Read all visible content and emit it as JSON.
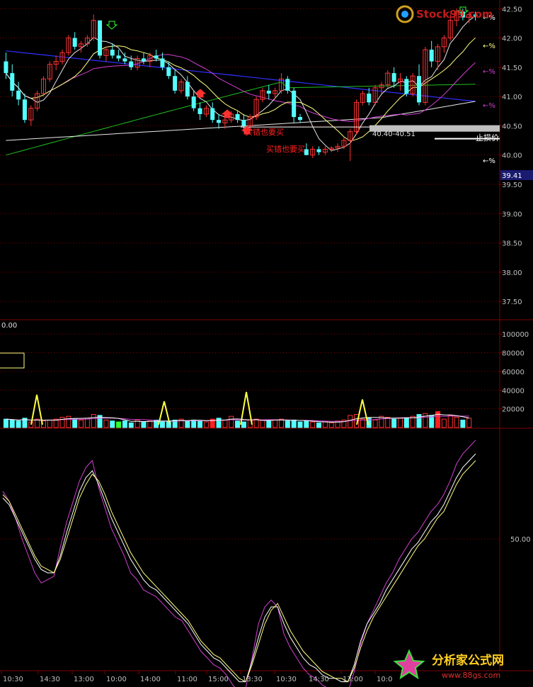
{
  "watermark_top": "Stock99.com",
  "watermark_bottom": {
    "title": "分析家公式网",
    "url": "www.88gs.com"
  },
  "colors": {
    "bg": "#000000",
    "grid": "#800000",
    "axis_text": "#c0c0c0",
    "up": "#ff3232",
    "down": "#54ffff",
    "ma_white": "#e8e8e8",
    "ma_yellow": "#ffff80",
    "ma_magenta": "#d040d0",
    "ma_blue": "#3030ff",
    "ma_green": "#20c020",
    "label_red": "#ff2020",
    "current_price_bg": "#1a1a70"
  },
  "chart_data": [
    {
      "type": "candlestick",
      "panel": "price",
      "ylim": [
        37.2,
        42.6
      ],
      "y_ticks": [
        "42.50",
        "42.00",
        "41.50",
        "41.00",
        "40.50",
        "40.00",
        "39.50",
        "39.00",
        "38.50",
        "38.00",
        "37.50"
      ],
      "current_price": "39.41",
      "candles": [
        [
          41.6,
          41.75,
          41.3,
          41.4
        ],
        [
          41.4,
          41.55,
          41.0,
          41.1
        ],
        [
          41.1,
          41.25,
          40.85,
          40.95
        ],
        [
          40.95,
          41.05,
          40.55,
          40.6
        ],
        [
          40.6,
          40.85,
          40.5,
          40.8
        ],
        [
          40.8,
          41.1,
          40.75,
          41.05
        ],
        [
          41.05,
          41.35,
          41.0,
          41.3
        ],
        [
          41.3,
          41.6,
          41.25,
          41.55
        ],
        [
          41.55,
          41.7,
          41.45,
          41.6
        ],
        [
          41.6,
          41.8,
          41.55,
          41.75
        ],
        [
          41.75,
          42.05,
          41.7,
          42.0
        ],
        [
          42.0,
          42.1,
          41.8,
          41.85
        ],
        [
          41.85,
          41.95,
          41.75,
          41.9
        ],
        [
          41.9,
          42.05,
          41.85,
          42.0
        ],
        [
          42.0,
          42.4,
          41.95,
          42.3
        ],
        [
          42.3,
          42.3,
          41.65,
          41.7
        ],
        [
          41.7,
          41.85,
          41.6,
          41.8
        ],
        [
          41.8,
          41.9,
          41.65,
          41.7
        ],
        [
          41.7,
          41.8,
          41.6,
          41.65
        ],
        [
          41.65,
          41.75,
          41.55,
          41.6
        ],
        [
          41.6,
          41.7,
          41.45,
          41.5
        ],
        [
          41.5,
          41.7,
          41.45,
          41.65
        ],
        [
          41.65,
          41.75,
          41.55,
          41.6
        ],
        [
          41.6,
          41.75,
          41.5,
          41.7
        ],
        [
          41.7,
          41.8,
          41.6,
          41.65
        ],
        [
          41.65,
          41.75,
          41.45,
          41.5
        ],
        [
          41.5,
          41.6,
          41.3,
          41.35
        ],
        [
          41.35,
          41.45,
          41.05,
          41.1
        ],
        [
          41.1,
          41.3,
          41.05,
          41.25
        ],
        [
          41.25,
          41.35,
          40.95,
          41.0
        ],
        [
          41.0,
          41.1,
          40.75,
          40.8
        ],
        [
          40.8,
          40.9,
          40.6,
          40.7
        ],
        [
          40.7,
          40.85,
          40.65,
          40.8
        ],
        [
          40.8,
          40.9,
          40.55,
          40.6
        ],
        [
          40.6,
          40.7,
          40.45,
          40.55
        ],
        [
          40.55,
          40.65,
          40.45,
          40.6
        ],
        [
          40.6,
          40.75,
          40.55,
          40.7
        ],
        [
          40.7,
          40.75,
          40.55,
          40.6
        ],
        [
          40.6,
          40.7,
          40.4,
          40.5
        ],
        [
          40.5,
          40.7,
          40.45,
          40.65
        ],
        [
          40.65,
          41.0,
          40.6,
          40.95
        ],
        [
          40.95,
          41.15,
          40.9,
          41.1
        ],
        [
          41.1,
          41.2,
          40.95,
          41.05
        ],
        [
          41.05,
          41.15,
          40.95,
          41.1
        ],
        [
          41.1,
          41.4,
          41.05,
          41.3
        ],
        [
          41.3,
          41.35,
          41.05,
          41.1
        ],
        [
          41.1,
          41.15,
          40.55,
          40.65
        ],
        [
          40.65,
          40.7,
          40.55,
          40.6
        ],
        [
          40.1,
          40.2,
          40.0,
          40.0
        ],
        [
          40.0,
          40.15,
          39.95,
          40.1
        ],
        [
          40.1,
          40.15,
          40.0,
          40.05
        ],
        [
          40.05,
          40.15,
          40.0,
          40.1
        ],
        [
          40.1,
          40.15,
          40.05,
          40.12
        ],
        [
          40.12,
          40.2,
          40.05,
          40.15
        ],
        [
          40.15,
          40.3,
          40.1,
          40.25
        ],
        [
          40.25,
          40.45,
          39.9,
          40.4
        ],
        [
          40.4,
          40.95,
          40.35,
          40.9
        ],
        [
          40.9,
          41.1,
          40.85,
          41.05
        ],
        [
          41.05,
          41.15,
          40.85,
          40.9
        ],
        [
          40.9,
          41.2,
          40.85,
          41.15
        ],
        [
          41.15,
          41.25,
          41.05,
          41.2
        ],
        [
          41.2,
          41.45,
          41.15,
          41.4
        ],
        [
          41.4,
          41.5,
          41.15,
          41.25
        ],
        [
          41.25,
          41.4,
          41.1,
          41.3
        ],
        [
          41.3,
          41.35,
          41.0,
          41.05
        ],
        [
          41.05,
          41.4,
          41.0,
          41.35
        ],
        [
          41.35,
          41.55,
          40.85,
          40.9
        ],
        [
          40.9,
          41.85,
          40.85,
          41.8
        ],
        [
          41.8,
          41.95,
          41.5,
          41.6
        ],
        [
          41.6,
          41.9,
          41.45,
          41.85
        ],
        [
          41.85,
          42.05,
          41.75,
          42.0
        ],
        [
          42.0,
          42.4,
          41.95,
          42.3
        ],
        [
          42.3,
          42.5,
          42.2,
          42.45
        ],
        [
          42.45,
          42.5,
          42.3,
          42.35
        ],
        [
          42.35,
          42.45,
          42.25,
          42.4
        ],
        [
          42.4,
          42.45,
          42.3,
          42.38
        ]
      ],
      "annotations": [
        "买错也要买",
        "买错也要买",
        "40.40-40.51",
        "止损价",
        "←%",
        "←%",
        "←%",
        "←%",
        "←%"
      ]
    },
    {
      "type": "bar",
      "panel": "volume",
      "ylim": [
        0,
        110000
      ],
      "y_ticks": [
        "100000",
        "80000",
        "60000",
        "40000",
        "20000"
      ],
      "header_value": "0.00",
      "values": [
        9000,
        8000,
        7000,
        10000,
        6000,
        9000,
        7000,
        8000,
        9000,
        11000,
        12000,
        9000,
        8000,
        10000,
        14000,
        13000,
        8000,
        7000,
        6000,
        7000,
        5000,
        8000,
        6000,
        7000,
        8000,
        6000,
        7000,
        8000,
        9000,
        7000,
        8000,
        7000,
        6000,
        9000,
        10000,
        8000,
        12000,
        7000,
        6000,
        8000,
        9000,
        8000,
        7000,
        8000,
        9000,
        7000,
        8000,
        6000,
        7000,
        6000,
        5000,
        6000,
        5000,
        7000,
        8000,
        13000,
        14000,
        9000,
        10000,
        8000,
        12000,
        11000,
        9000,
        10000,
        10000,
        12000,
        14000,
        15000,
        13000,
        17000,
        9000,
        13000,
        11000,
        8000,
        10000
      ],
      "spike_values": [
        35000,
        28000,
        38000,
        30000
      ]
    },
    {
      "type": "line",
      "panel": "oscillator",
      "ylim": [
        0,
        100
      ],
      "y_ticks": [
        "50.00"
      ],
      "series": [
        {
          "color": "#d040d0",
          "values": [
            78,
            72,
            62,
            50,
            40,
            30,
            24,
            26,
            28,
            45,
            60,
            72,
            84,
            92,
            96,
            80,
            68,
            56,
            48,
            40,
            30,
            26,
            20,
            18,
            16,
            12,
            8,
            4,
            2,
            -4,
            -10,
            -16,
            -20,
            -24,
            -26,
            -30,
            -36,
            -40,
            -38,
            -20,
            0,
            10,
            14,
            10,
            -6,
            -14,
            -20,
            -26,
            -30,
            -32,
            -36,
            -38,
            -38,
            -40,
            -40,
            -28,
            -12,
            0,
            8,
            16,
            24,
            30,
            38,
            44,
            50,
            54,
            60,
            66,
            70,
            76,
            84,
            94,
            100,
            104,
            108
          ]
        },
        {
          "color": "#ffffff",
          "values": [
            74,
            70,
            62,
            54,
            46,
            38,
            32,
            30,
            30,
            40,
            54,
            66,
            78,
            86,
            90,
            82,
            72,
            62,
            54,
            46,
            38,
            32,
            26,
            22,
            20,
            16,
            12,
            8,
            4,
            0,
            -6,
            -12,
            -16,
            -20,
            -22,
            -26,
            -30,
            -34,
            -34,
            -22,
            -8,
            4,
            10,
            10,
            0,
            -8,
            -14,
            -20,
            -24,
            -26,
            -30,
            -32,
            -32,
            -34,
            -34,
            -24,
            -10,
            0,
            6,
            12,
            20,
            26,
            32,
            38,
            44,
            48,
            54,
            60,
            64,
            70,
            78,
            86,
            92,
            96,
            100
          ]
        },
        {
          "color": "#ffff80",
          "values": [
            76,
            72,
            64,
            56,
            48,
            40,
            34,
            32,
            30,
            38,
            50,
            62,
            74,
            82,
            88,
            84,
            76,
            66,
            58,
            50,
            42,
            36,
            30,
            26,
            22,
            18,
            14,
            10,
            6,
            2,
            -4,
            -10,
            -14,
            -18,
            -20,
            -24,
            -28,
            -32,
            -34,
            -24,
            -12,
            0,
            8,
            12,
            4,
            -4,
            -10,
            -16,
            -20,
            -24,
            -28,
            -30,
            -32,
            -32,
            -34,
            -26,
            -14,
            -4,
            4,
            10,
            16,
            22,
            28,
            34,
            40,
            46,
            50,
            56,
            62,
            66,
            74,
            82,
            88,
            92,
            96
          ]
        }
      ]
    }
  ],
  "x_axis_labels": [
    "10:30",
    "14:30",
    "13:00",
    "10:00",
    "14:00",
    "11:00",
    "15:00",
    "13:30",
    "10:30",
    "14:30",
    "13:00",
    "10:0"
  ]
}
